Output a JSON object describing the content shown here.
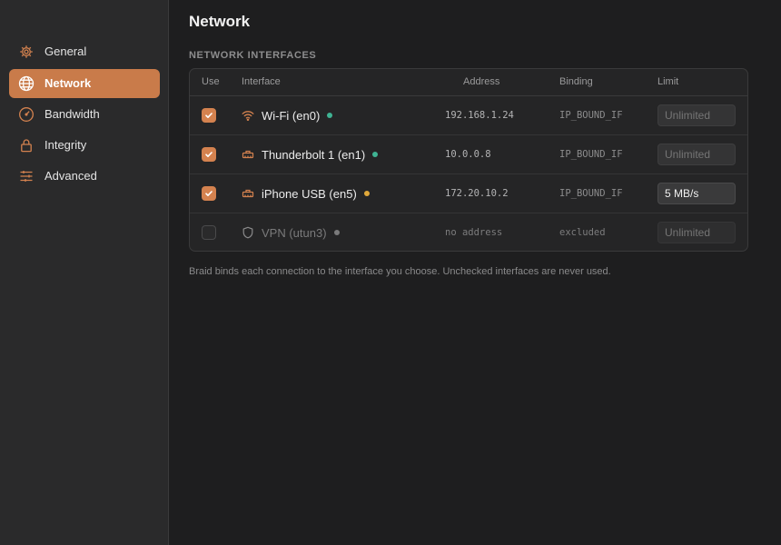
{
  "colors": {
    "accent": "#c97b4a",
    "status_green": "#3fb393",
    "status_amber": "#e0a83a",
    "status_gray": "#7a7a7b"
  },
  "sidebar": {
    "items": [
      {
        "label": "General",
        "icon": "gear-icon",
        "active": false
      },
      {
        "label": "Network",
        "icon": "globe-icon",
        "active": true
      },
      {
        "label": "Bandwidth",
        "icon": "gauge-icon",
        "active": false
      },
      {
        "label": "Integrity",
        "icon": "lock-icon",
        "active": false
      },
      {
        "label": "Advanced",
        "icon": "sliders-icon",
        "active": false
      }
    ]
  },
  "main": {
    "title": "Network",
    "section_title": "NETWORK INTERFACES",
    "columns": {
      "use": "Use",
      "interface": "Interface",
      "address": "Address",
      "binding": "Binding",
      "limit": "Limit"
    },
    "rows": [
      {
        "checked": true,
        "icon": "wifi-icon",
        "name": "Wi-Fi (en0)",
        "status": "status_green",
        "address": "192.168.1.24",
        "binding": "IP_BOUND_IF",
        "limit_value": "",
        "limit_placeholder": "Unlimited",
        "enabled": true
      },
      {
        "checked": true,
        "icon": "ethernet-icon",
        "name": "Thunderbolt 1 (en1)",
        "status": "status_green",
        "address": "10.0.0.8",
        "binding": "IP_BOUND_IF",
        "limit_value": "",
        "limit_placeholder": "Unlimited",
        "enabled": true
      },
      {
        "checked": true,
        "icon": "ethernet-icon",
        "name": "iPhone USB (en5)",
        "status": "status_amber",
        "address": "172.20.10.2",
        "binding": "IP_BOUND_IF",
        "limit_value": "5 MB/s",
        "limit_placeholder": "Unlimited",
        "enabled": true
      },
      {
        "checked": false,
        "icon": "shield-icon",
        "name": "VPN (utun3)",
        "status": "status_gray",
        "address": "no address",
        "binding": "excluded",
        "limit_value": "",
        "limit_placeholder": "Unlimited",
        "enabled": false
      }
    ],
    "footnote": "Braid binds each connection to the interface you choose. Unchecked interfaces are never used."
  }
}
